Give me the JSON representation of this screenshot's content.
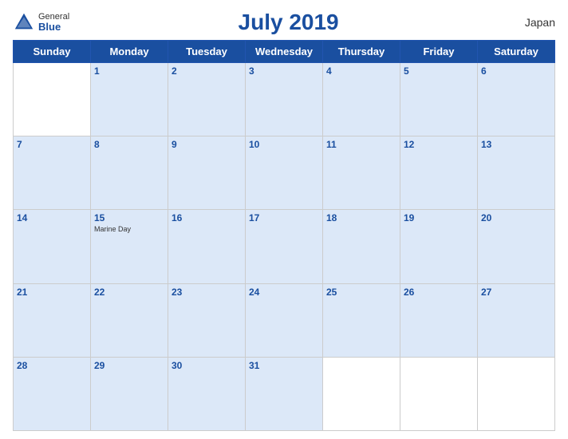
{
  "header": {
    "logo_general": "General",
    "logo_blue": "Blue",
    "title": "July 2019",
    "country": "Japan"
  },
  "days": [
    "Sunday",
    "Monday",
    "Tuesday",
    "Wednesday",
    "Thursday",
    "Friday",
    "Saturday"
  ],
  "weeks": [
    [
      {
        "date": "",
        "holiday": ""
      },
      {
        "date": "1",
        "holiday": ""
      },
      {
        "date": "2",
        "holiday": ""
      },
      {
        "date": "3",
        "holiday": ""
      },
      {
        "date": "4",
        "holiday": ""
      },
      {
        "date": "5",
        "holiday": ""
      },
      {
        "date": "6",
        "holiday": ""
      }
    ],
    [
      {
        "date": "7",
        "holiday": ""
      },
      {
        "date": "8",
        "holiday": ""
      },
      {
        "date": "9",
        "holiday": ""
      },
      {
        "date": "10",
        "holiday": ""
      },
      {
        "date": "11",
        "holiday": ""
      },
      {
        "date": "12",
        "holiday": ""
      },
      {
        "date": "13",
        "holiday": ""
      }
    ],
    [
      {
        "date": "14",
        "holiday": ""
      },
      {
        "date": "15",
        "holiday": "Marine Day"
      },
      {
        "date": "16",
        "holiday": ""
      },
      {
        "date": "17",
        "holiday": ""
      },
      {
        "date": "18",
        "holiday": ""
      },
      {
        "date": "19",
        "holiday": ""
      },
      {
        "date": "20",
        "holiday": ""
      }
    ],
    [
      {
        "date": "21",
        "holiday": ""
      },
      {
        "date": "22",
        "holiday": ""
      },
      {
        "date": "23",
        "holiday": ""
      },
      {
        "date": "24",
        "holiday": ""
      },
      {
        "date": "25",
        "holiday": ""
      },
      {
        "date": "26",
        "holiday": ""
      },
      {
        "date": "27",
        "holiday": ""
      }
    ],
    [
      {
        "date": "28",
        "holiday": ""
      },
      {
        "date": "29",
        "holiday": ""
      },
      {
        "date": "30",
        "holiday": ""
      },
      {
        "date": "31",
        "holiday": ""
      },
      {
        "date": "",
        "holiday": ""
      },
      {
        "date": "",
        "holiday": ""
      },
      {
        "date": "",
        "holiday": ""
      }
    ]
  ],
  "colors": {
    "header_bg": "#1a4fa0",
    "cell_blue": "#dce8f8",
    "date_color": "#1a4fa0"
  }
}
